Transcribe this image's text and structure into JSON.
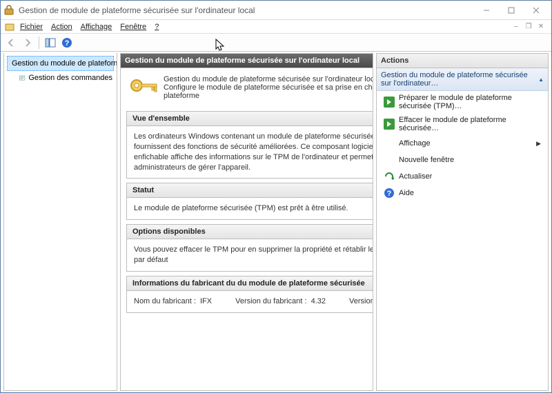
{
  "window": {
    "title": "Gestion de module de plateforme sécurisée sur l'ordinateur local"
  },
  "menu": {
    "file": "Fichier",
    "action": "Action",
    "view": "Affichage",
    "window": "Fenêtre",
    "help": "?"
  },
  "tree": {
    "root": "Gestion du module de plateforme :",
    "child": "Gestion des commandes"
  },
  "center": {
    "header": "Gestion du module de plateforme sécurisée sur l'ordinateur local",
    "intro_line1": "Gestion du module de plateforme sécurisée sur l'ordinateur local",
    "intro_line2": "Configure le module de plateforme sécurisée et sa prise en charge par la plateforme",
    "sections": {
      "overview": {
        "title": "Vue d'ensemble",
        "body": "Les ordinateurs Windows contenant un module de plateforme sécurisée (TPM) fournissent des fonctions de sécurité améliorées. Ce composant logiciel enfichable affiche des informations sur le TPM de l'ordinateur et permet aux administrateurs de gérer l'appareil."
      },
      "status": {
        "title": "Statut",
        "body": "Le module de plateforme sécurisée (TPM) est prêt à être utilisé."
      },
      "options": {
        "title": "Options disponibles",
        "body": "Vous pouvez effacer le TPM pour en supprimer la propriété et rétablir les valeurs par défaut"
      },
      "mfg": {
        "title": "Informations du fabricant du du module de plateforme sécurisée",
        "name_label": "Nom du fabricant :",
        "name_value": "IFX",
        "ver_label": "Version du fabricant :",
        "ver_value": "4.32",
        "spec_label": "Version de la spécificatio"
      }
    }
  },
  "actions": {
    "header": "Actions",
    "group": "Gestion du module de plateforme sécurisée sur l'ordinateur…",
    "items": {
      "prepare": "Préparer le module de plateforme sécurisée (TPM)…",
      "clear": "Effacer le module de plateforme sécurisée…",
      "display": "Affichage",
      "newwin": "Nouvelle fenêtre",
      "refresh": "Actualiser",
      "help": "Aide"
    }
  }
}
